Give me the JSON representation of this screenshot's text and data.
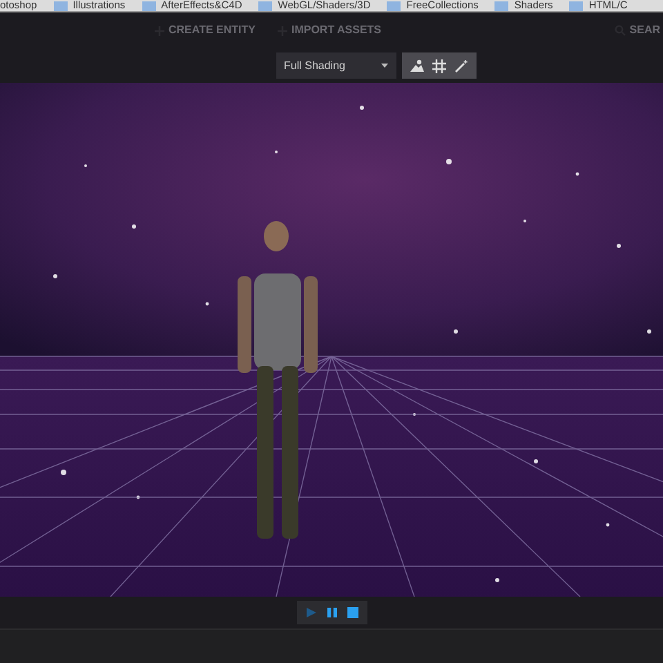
{
  "bookmarks": [
    "otoshop",
    "Illustrations",
    "AfterEffects&C4D",
    "WebGL/Shaders/3D",
    "FreeCollections",
    "Shaders",
    "HTML/C"
  ],
  "header": {
    "actions": [
      "CREATE ENTITY",
      "IMPORT ASSETS"
    ],
    "search": "SEAR"
  },
  "toolbar": {
    "shading": "Full Shading",
    "tools": [
      {
        "kind": "scene"
      },
      {
        "kind": "grid"
      },
      {
        "kind": "wand"
      }
    ]
  },
  "playback": [
    {
      "kind": "play",
      "active": false
    },
    {
      "kind": "pause",
      "active": true
    },
    {
      "kind": "stop",
      "active": true
    }
  ]
}
